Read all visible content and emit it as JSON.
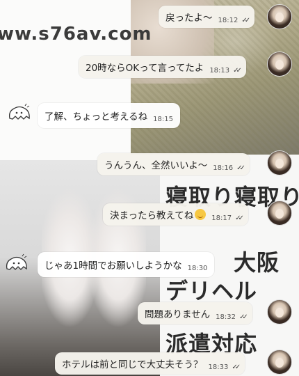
{
  "watermark": "ww.s76av.com",
  "ad_lines": [
    "寝取り寝取り",
    "大阪",
    "デリヘル",
    "派遣対応"
  ],
  "messages": [
    {
      "side": "me",
      "text": "戻ったよ〜",
      "time": "18:12",
      "check": "✓✓"
    },
    {
      "side": "me",
      "text": "20時ならOKって言ってたよ",
      "time": "18:13",
      "check": "✓✓"
    },
    {
      "side": "other",
      "text": "了解、ちょっと考えるね",
      "time": "18:15"
    },
    {
      "side": "me",
      "text": "うんうん、全然いいよ〜",
      "time": "18:16",
      "check": "✓✓"
    },
    {
      "side": "me",
      "text": "決まったら教えてね",
      "time": "18:17",
      "check": "✓✓",
      "emoji": "smiling-face"
    },
    {
      "side": "other",
      "text": "じゃあ1時間でお願いしようかな",
      "time": "18:30"
    },
    {
      "side": "me",
      "text": "問題ありません",
      "time": "18:32",
      "check": "✓✓"
    },
    {
      "side": "me",
      "text": "ホテルは前と同じで大丈夫そう？",
      "time": "18:33",
      "check": "✓✓"
    }
  ]
}
